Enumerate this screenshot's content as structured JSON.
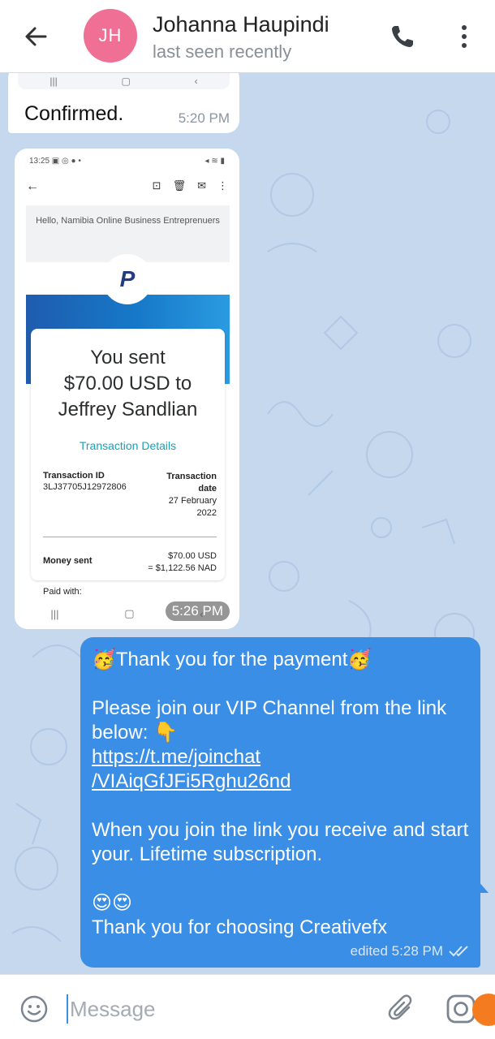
{
  "header": {
    "avatar_initials": "JH",
    "avatar_color": "#ef6f95",
    "name": "Johanna Haupindi",
    "status": "last seen recently",
    "back_icon": "arrow-left-icon",
    "call_icon": "phone-icon",
    "more_icon": "more-vertical-icon"
  },
  "messages": [
    {
      "direction": "incoming",
      "text": "Confirmed.",
      "time": "5:20 PM"
    },
    {
      "direction": "incoming",
      "type": "image",
      "time": "5:26 PM",
      "screenshot": {
        "status_time": "13:25",
        "hello_text": "Hello, Namibia Online Business Entreprenuers",
        "logo": "P",
        "sent_line1": "You sent",
        "sent_line2": "$70.00 USD to",
        "sent_line3": "Jeffrey Sandlian",
        "details_link": "Transaction Details",
        "tx_id_label": "Transaction ID",
        "tx_id_value": "3LJ37705J12972806",
        "tx_date_label": "Transaction date",
        "tx_date_value": "27 February 2022",
        "money_label": "Money sent",
        "money_usd": "$70.00 USD",
        "money_nad": "= $1,122.56 NAD",
        "paid_with": "Paid with:"
      }
    },
    {
      "direction": "outgoing",
      "line1": "🥳Thank you for the payment🥳",
      "line2": "Please join our VIP Channel from the link below: 👇",
      "link_part1": "https://t.me/joinchat",
      "link_part2": "/VIAiqGfJFi5Rghu26nd",
      "line3": "When you join the link you receive and start your. Lifetime subscription.",
      "line4": "😍😍",
      "line5": "Thank you for choosing Creativefx",
      "meta": "edited 5:28 PM",
      "bubble_color": "#3a8ee6"
    }
  ],
  "composer": {
    "placeholder": "Message",
    "emoji_icon": "smiley-icon",
    "attach_icon": "paperclip-icon",
    "camera_icon": "camera-icon"
  }
}
